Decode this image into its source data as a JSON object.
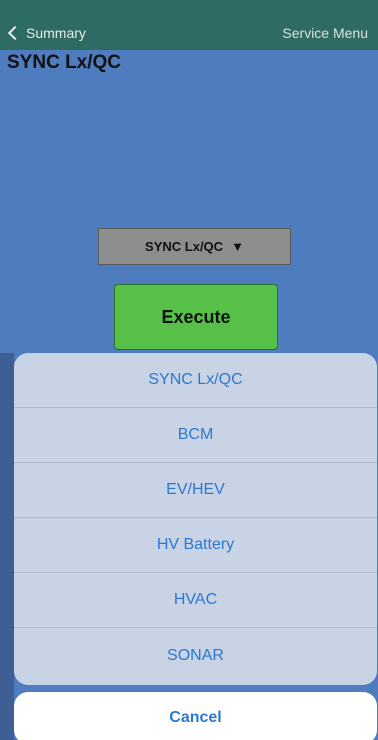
{
  "navbar": {
    "back_label": "Summary",
    "right_label": "Service Menu"
  },
  "page": {
    "title": "SYNC Lx/QC"
  },
  "dropdown": {
    "selected": "SYNC Lx/QC",
    "arrow": "▼"
  },
  "execute": {
    "label": "Execute"
  },
  "action_sheet": {
    "options": [
      "SYNC Lx/QC",
      "BCM",
      "EV/HEV",
      "HV Battery",
      "HVAC",
      "SONAR"
    ],
    "cancel_label": "Cancel"
  },
  "colors": {
    "navbar": "#2e6b63",
    "background": "#4f7bbf",
    "execute": "#56c049",
    "sheet": "#c9d3e6",
    "accent_text": "#2d78d0"
  }
}
